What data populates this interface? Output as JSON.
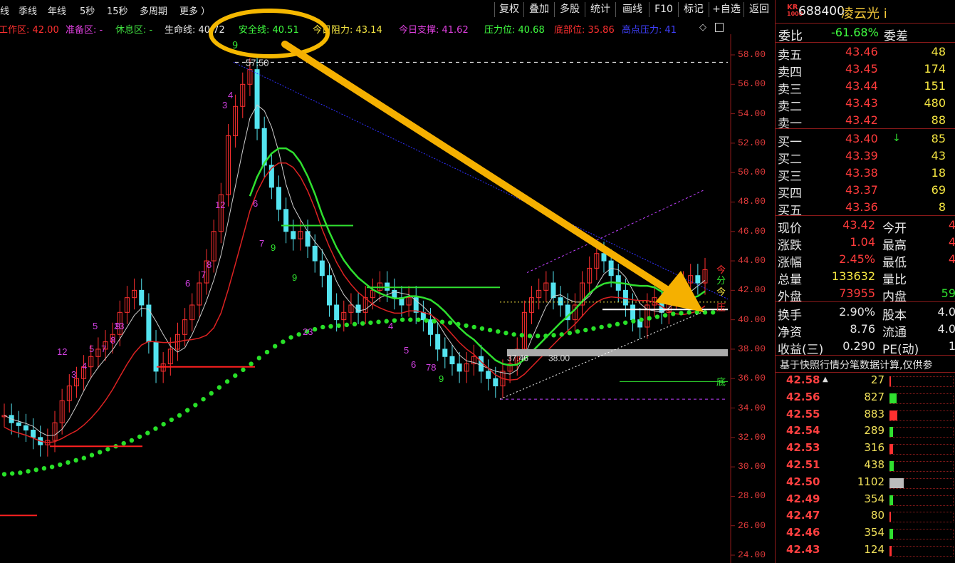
{
  "toolbar": {
    "periods": [
      "线",
      "季线",
      "年线",
      "5秒",
      "15秒",
      "多周期",
      "更多 ）"
    ],
    "buttons": [
      "复权",
      "叠加",
      "多股",
      "统计",
      "画线",
      "F10",
      "标记",
      "+自选",
      "返回"
    ]
  },
  "indicators": [
    {
      "text": "工作区: 42.00",
      "color": "#ff3030"
    },
    {
      "text": "准备区: -",
      "color": "#e040e0"
    },
    {
      "text": "休息区: -",
      "color": "#40e040"
    },
    {
      "text": "生命线: 40.72",
      "color": "#e6e6e6"
    },
    {
      "text": "安全线: 40.51",
      "color": "#40ff40"
    },
    {
      "text": "今日阻力: 43.14",
      "color": "#f5e642"
    },
    {
      "text": "今日支撑: 41.62",
      "color": "#e040e0"
    },
    {
      "text": "压力位: 40.68",
      "color": "#40ff40"
    },
    {
      "text": "底部位: 35.86",
      "color": "#ff3030"
    },
    {
      "text": "高点压力: 41",
      "color": "#4040ff"
    }
  ],
  "chart_annotations": {
    "peak_label": "57.50",
    "circle_note": "9",
    "low_labels": [
      "37.46",
      "38.00"
    ],
    "side_tags": [
      "今",
      "分",
      "今",
      "压"
    ],
    "bottom_tag": "底",
    "seq_numbers": [
      "12",
      "3",
      "4",
      "5",
      "7",
      "8",
      "9",
      "23",
      "5",
      "6",
      "7",
      "8",
      "12",
      "3",
      "4",
      "6",
      "7",
      "9",
      "9",
      "23",
      "4",
      "5",
      "6",
      "78",
      "9"
    ]
  },
  "chart_data": {
    "type": "line",
    "title": "",
    "y_ticks": [
      "58.00",
      "56.00",
      "54.00",
      "52.00",
      "50.00",
      "48.00",
      "46.00",
      "44.00",
      "42.00",
      "40.00",
      "38.00",
      "36.00",
      "34.00",
      "32.00",
      "30.00",
      "28.00",
      "26.00",
      "24.00"
    ],
    "ylim": [
      24,
      58
    ],
    "candles_close": [
      33.5,
      33.0,
      32.8,
      32.5,
      32.0,
      31.5,
      31.8,
      33.0,
      34.5,
      35.5,
      36.0,
      36.8,
      37.5,
      38.0,
      38.5,
      39.0,
      40.5,
      41.5,
      42.0,
      41.0,
      38.5,
      36.5,
      37.0,
      38.0,
      39.0,
      40.0,
      41.0,
      42.5,
      44.0,
      46.0,
      48.5,
      52.5,
      54.5,
      56.0,
      57.0,
      53.0,
      50.5,
      49.0,
      47.5,
      46.0,
      45.5,
      46.0,
      45.0,
      44.0,
      43.0,
      41.0,
      40.0,
      40.5,
      41.0,
      40.5,
      41.5,
      42.0,
      42.5,
      42.0,
      41.5,
      41.0,
      41.5,
      40.5,
      40.0,
      39.0,
      38.0,
      37.5,
      37.0,
      36.5,
      37.0,
      37.5,
      36.5,
      36.0,
      35.5,
      36.5,
      37.0,
      38.0,
      40.5,
      41.5,
      42.0,
      42.5,
      41.5,
      41.0,
      40.0,
      41.0,
      42.5,
      43.5,
      44.5,
      44.0,
      43.0,
      42.0,
      41.0,
      40.0,
      39.5,
      41.0,
      41.5,
      40.5,
      41.5,
      42.0,
      42.5,
      43.0,
      42.5,
      43.4
    ],
    "safety_line_dots": [
      29.5,
      29.6,
      29.8,
      30.0,
      30.3,
      30.6,
      31.0,
      31.4,
      31.8,
      32.3,
      32.9,
      33.5,
      34.2,
      35.0,
      35.8,
      36.6,
      37.4,
      38.2,
      38.8,
      39.2,
      39.5,
      39.6,
      39.7,
      39.8,
      39.9,
      40.0,
      40.0,
      39.9,
      39.8,
      39.6,
      39.4,
      39.2,
      39.0,
      38.9,
      38.9,
      39.0,
      39.2,
      39.4,
      39.6,
      39.8,
      40.0,
      40.2,
      40.4,
      40.5,
      40.5
    ]
  },
  "right_panel": {
    "kr_label": "KR\n1000",
    "code": "688400",
    "name": "凌云光 i",
    "weibi": {
      "label": "委比",
      "value": "-61.68%",
      "label2": "委差"
    },
    "asks": [
      {
        "label": "卖五",
        "price": "43.46",
        "vol": "48"
      },
      {
        "label": "卖四",
        "price": "43.45",
        "vol": "174"
      },
      {
        "label": "卖三",
        "price": "43.44",
        "vol": "151"
      },
      {
        "label": "卖二",
        "price": "43.43",
        "vol": "480"
      },
      {
        "label": "卖一",
        "price": "43.42",
        "vol": "88"
      }
    ],
    "bids": [
      {
        "label": "买一",
        "price": "43.40",
        "vol": "85"
      },
      {
        "label": "买二",
        "price": "43.39",
        "vol": "43"
      },
      {
        "label": "买三",
        "price": "43.38",
        "vol": "18"
      },
      {
        "label": "买四",
        "price": "43.37",
        "vol": "69"
      },
      {
        "label": "买五",
        "price": "43.36",
        "vol": "8"
      }
    ],
    "stats": [
      {
        "l": "现价",
        "v": "43.42",
        "l2": "今开",
        "v2": "4"
      },
      {
        "l": "涨跌",
        "v": "1.04",
        "l2": "最高",
        "v2": "4"
      },
      {
        "l": "涨幅",
        "v": "2.45%",
        "l2": "最低",
        "v2": "4"
      },
      {
        "l": "总量",
        "v": "133632",
        "l2": "量比",
        "v2": ""
      },
      {
        "l": "外盘",
        "v": "73955",
        "l2": "内盘",
        "v2": "59"
      }
    ],
    "stats2": [
      {
        "l": "换手",
        "v": "2.90%",
        "l2": "股本",
        "v2": "4.0"
      },
      {
        "l": "净资",
        "v": "8.76",
        "l2": "流通",
        "v2": "4.0"
      },
      {
        "l": "收益(三)",
        "v": "0.290",
        "l2": "PE(动)",
        "v2": "1"
      }
    ],
    "note": "基于快照行情分笔数据计算,仅供参",
    "ticks": [
      {
        "p": "42.58",
        "v": "27",
        "bar": 0.0,
        "mark": "▲"
      },
      {
        "p": "42.56",
        "v": "827",
        "bar": 0.5,
        "mark": ""
      },
      {
        "p": "42.55",
        "v": "883",
        "bar": 0.55,
        "mark": ""
      },
      {
        "p": "42.54",
        "v": "289",
        "bar": 0.25,
        "mark": ""
      },
      {
        "p": "42.53",
        "v": "316",
        "bar": 0.25,
        "mark": ""
      },
      {
        "p": "42.51",
        "v": "438",
        "bar": 0.3,
        "mark": ""
      },
      {
        "p": "42.50",
        "v": "1102",
        "bar": 1.0,
        "mark": ""
      },
      {
        "p": "42.49",
        "v": "354",
        "bar": 0.25,
        "mark": ""
      },
      {
        "p": "42.47",
        "v": "80",
        "bar": 0.1,
        "mark": ""
      },
      {
        "p": "42.46",
        "v": "354",
        "bar": 0.25,
        "mark": ""
      },
      {
        "p": "42.43",
        "v": "124",
        "bar": 0.15,
        "mark": ""
      }
    ]
  }
}
